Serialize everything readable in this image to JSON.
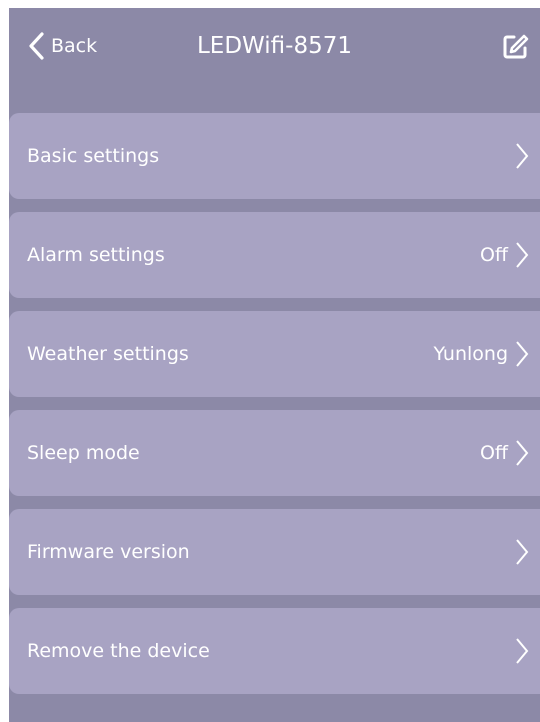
{
  "header": {
    "back_label": "Back",
    "title": "LEDWifi-8571",
    "edit_icon": "edit-icon"
  },
  "rows": [
    {
      "label": "Basic settings",
      "value": ""
    },
    {
      "label": "Alarm settings",
      "value": "Off"
    },
    {
      "label": "Weather settings",
      "value": "Yunlong"
    },
    {
      "label": "Sleep mode",
      "value": "Off"
    },
    {
      "label": "Firmware version",
      "value": ""
    },
    {
      "label": "Remove the device",
      "value": ""
    }
  ],
  "colors": {
    "background": "#8c89a7",
    "row": "#a8a3c3",
    "text": "#ffffff"
  }
}
